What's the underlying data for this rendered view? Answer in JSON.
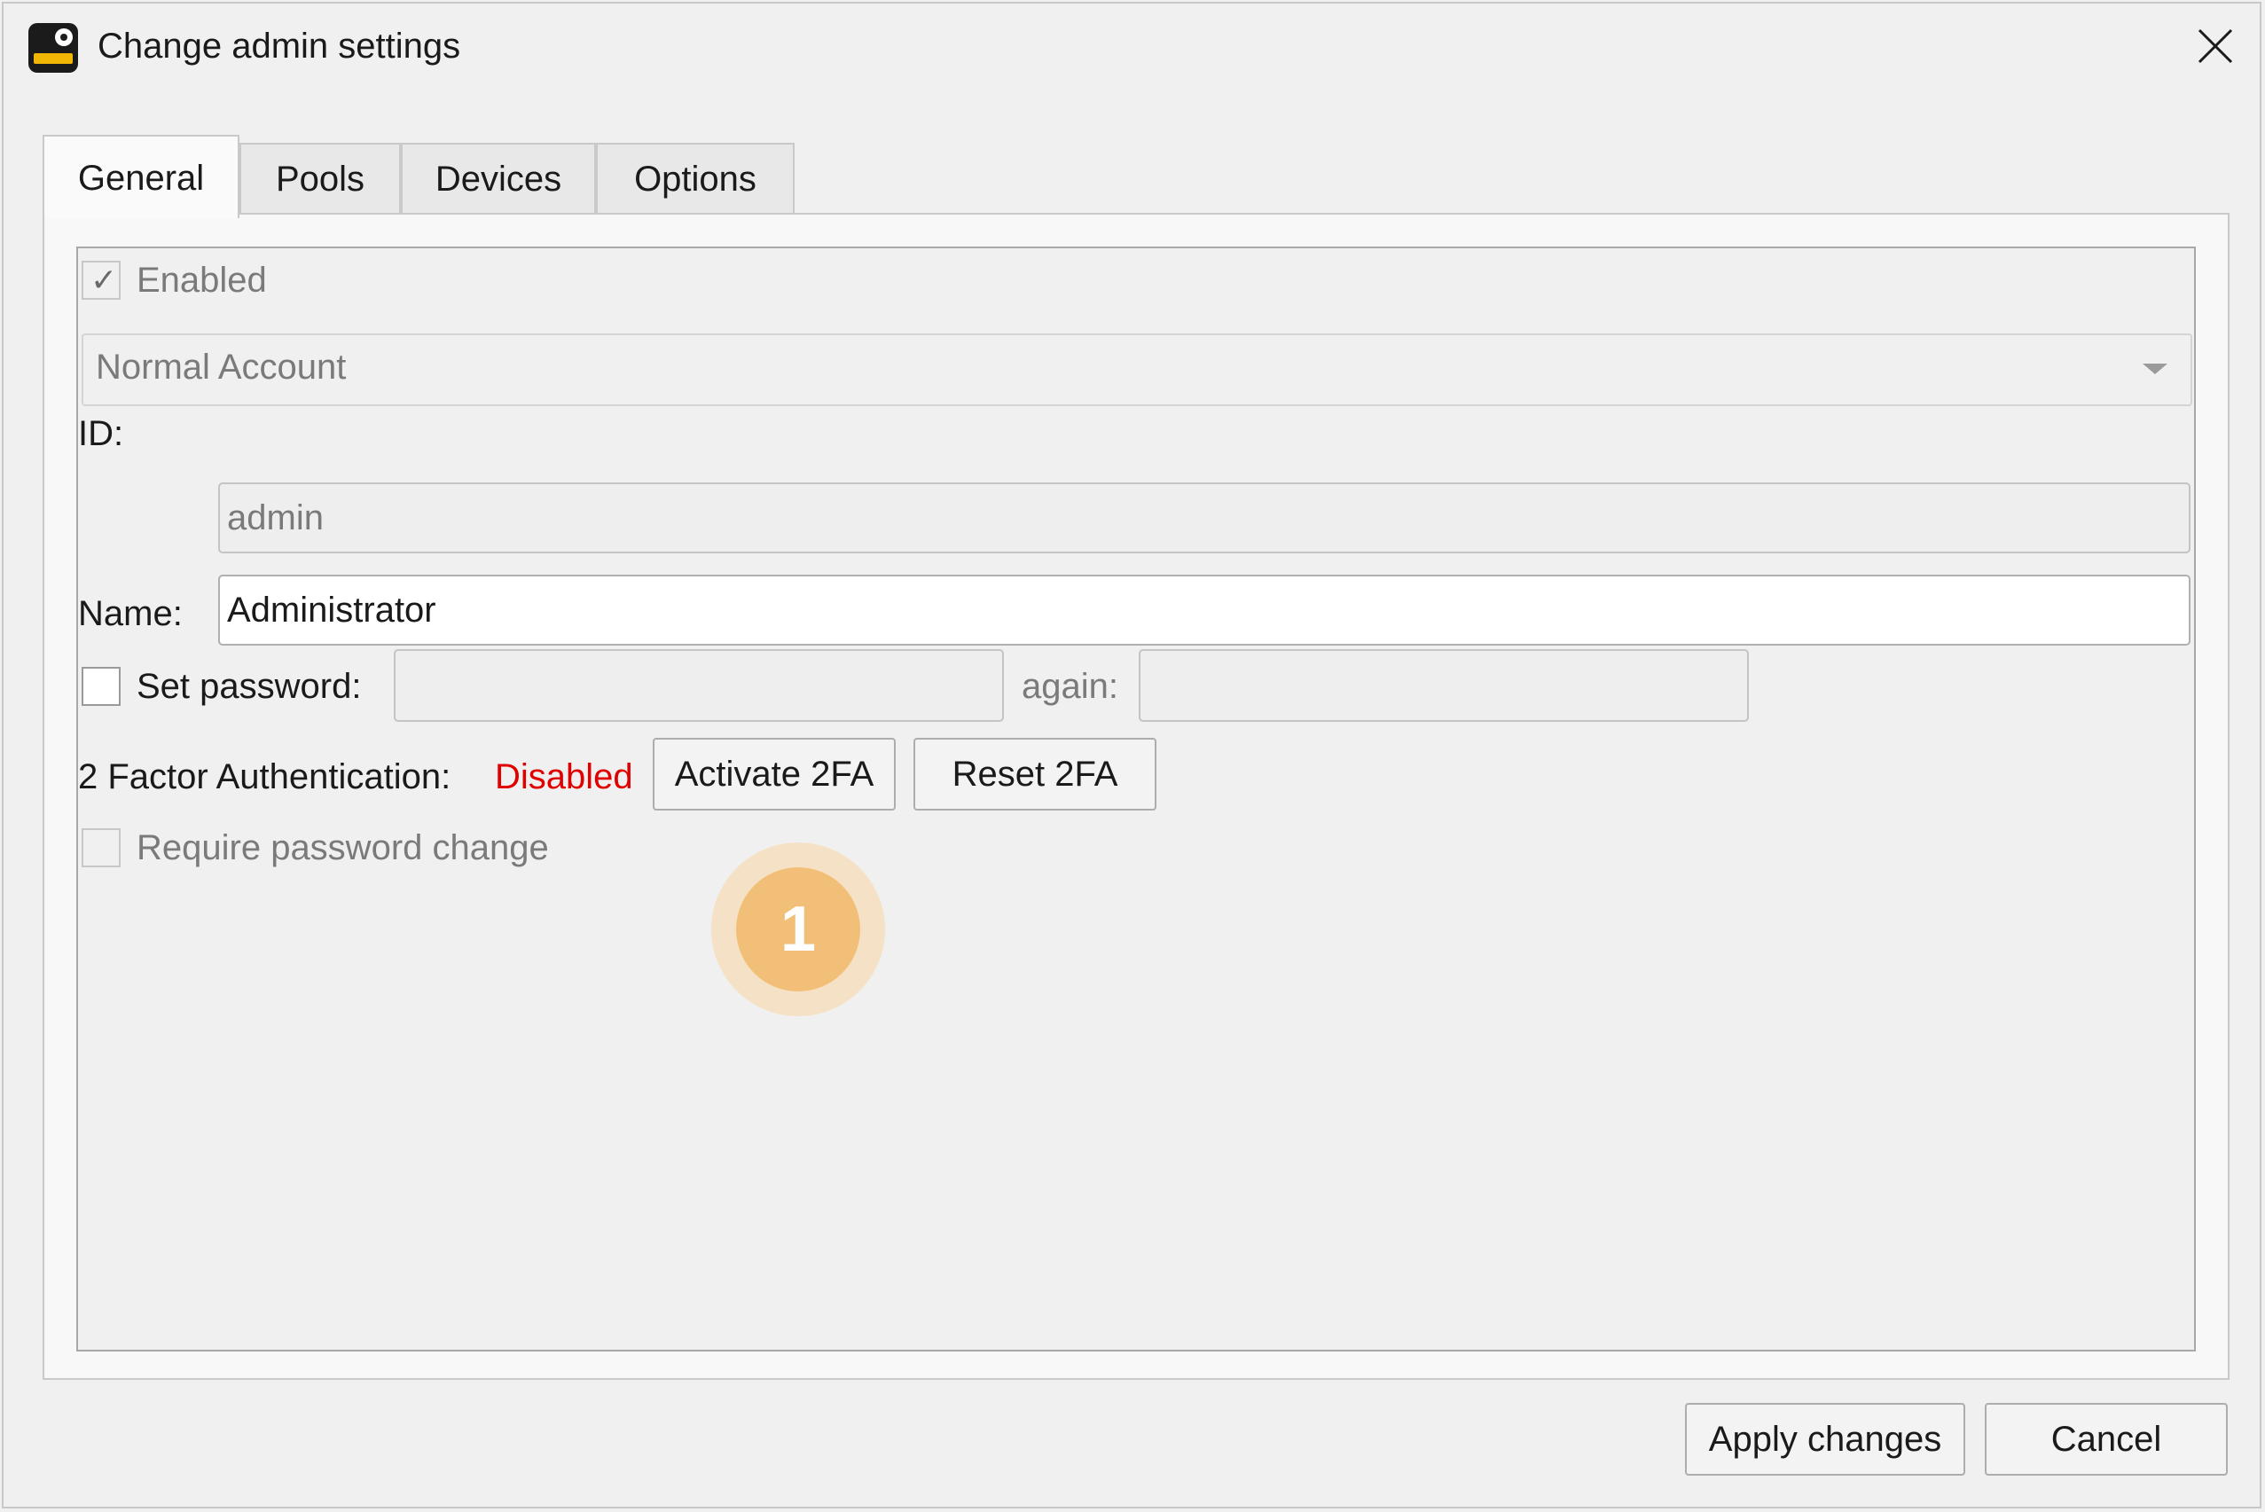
{
  "window": {
    "title": "Change admin settings"
  },
  "tabs": [
    {
      "label": "General",
      "active": true
    },
    {
      "label": "Pools",
      "active": false
    },
    {
      "label": "Devices",
      "active": false
    },
    {
      "label": "Options",
      "active": false
    }
  ],
  "general": {
    "enabled": {
      "label": "Enabled",
      "checked": true,
      "disabled": true
    },
    "account_type": {
      "selected": "Normal Account"
    },
    "id": {
      "label": "ID:",
      "value": "admin"
    },
    "name": {
      "label": "Name:",
      "value": "Administrator"
    },
    "set_password": {
      "label": "Set password:",
      "checked": false,
      "again_label": "again:",
      "value": "",
      "again_value": ""
    },
    "two_factor": {
      "label": "2 Factor Authentication:",
      "status": "Disabled",
      "status_color": "#e00000",
      "activate_label": "Activate 2FA",
      "reset_label": "Reset 2FA"
    },
    "require_password_change": {
      "label": "Require password change",
      "checked": false,
      "disabled": true
    }
  },
  "callout": {
    "number": "1",
    "color": "#f2bf78"
  },
  "footer": {
    "apply_label": "Apply changes",
    "cancel_label": "Cancel"
  }
}
